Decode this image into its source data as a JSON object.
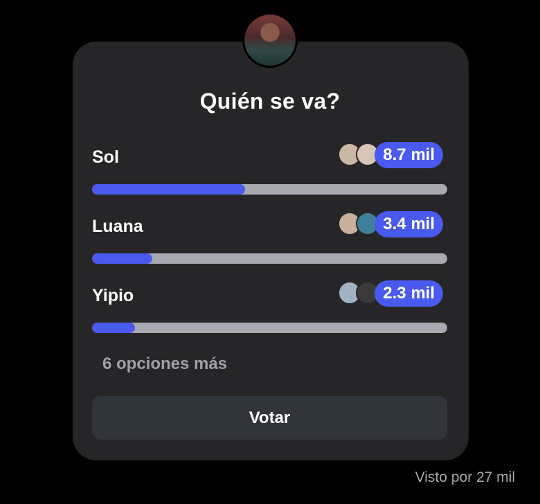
{
  "poll": {
    "question": "Quién se va?",
    "options": [
      {
        "label": "Sol",
        "count": "8.7 mil",
        "fraction": 0.43,
        "voters": [
          {
            "icon": "voter-avatar",
            "color": "#c9b8a4"
          },
          {
            "icon": "voter-avatar",
            "color": "#d8c6b6"
          }
        ]
      },
      {
        "label": "Luana",
        "count": "3.4 mil",
        "fraction": 0.17,
        "voters": [
          {
            "icon": "voter-avatar",
            "color": "#c7b09c"
          },
          {
            "icon": "voter-avatar",
            "color": "#3f7f9c"
          }
        ]
      },
      {
        "label": "Yipio",
        "count": "2.3 mil",
        "fraction": 0.12,
        "voters": [
          {
            "icon": "voter-avatar",
            "color": "#9fb3c4"
          },
          {
            "icon": "voter-avatar",
            "color": "#3a3a3a"
          }
        ]
      }
    ],
    "more_options": "6 opciones más",
    "vote_label": "Votar",
    "seen_by": "Visto por 27 mil"
  },
  "colors": {
    "background": "#000000",
    "card": "#262628",
    "accent": "#4a5aee",
    "track": "#a9aab1",
    "button": "#30343b"
  }
}
